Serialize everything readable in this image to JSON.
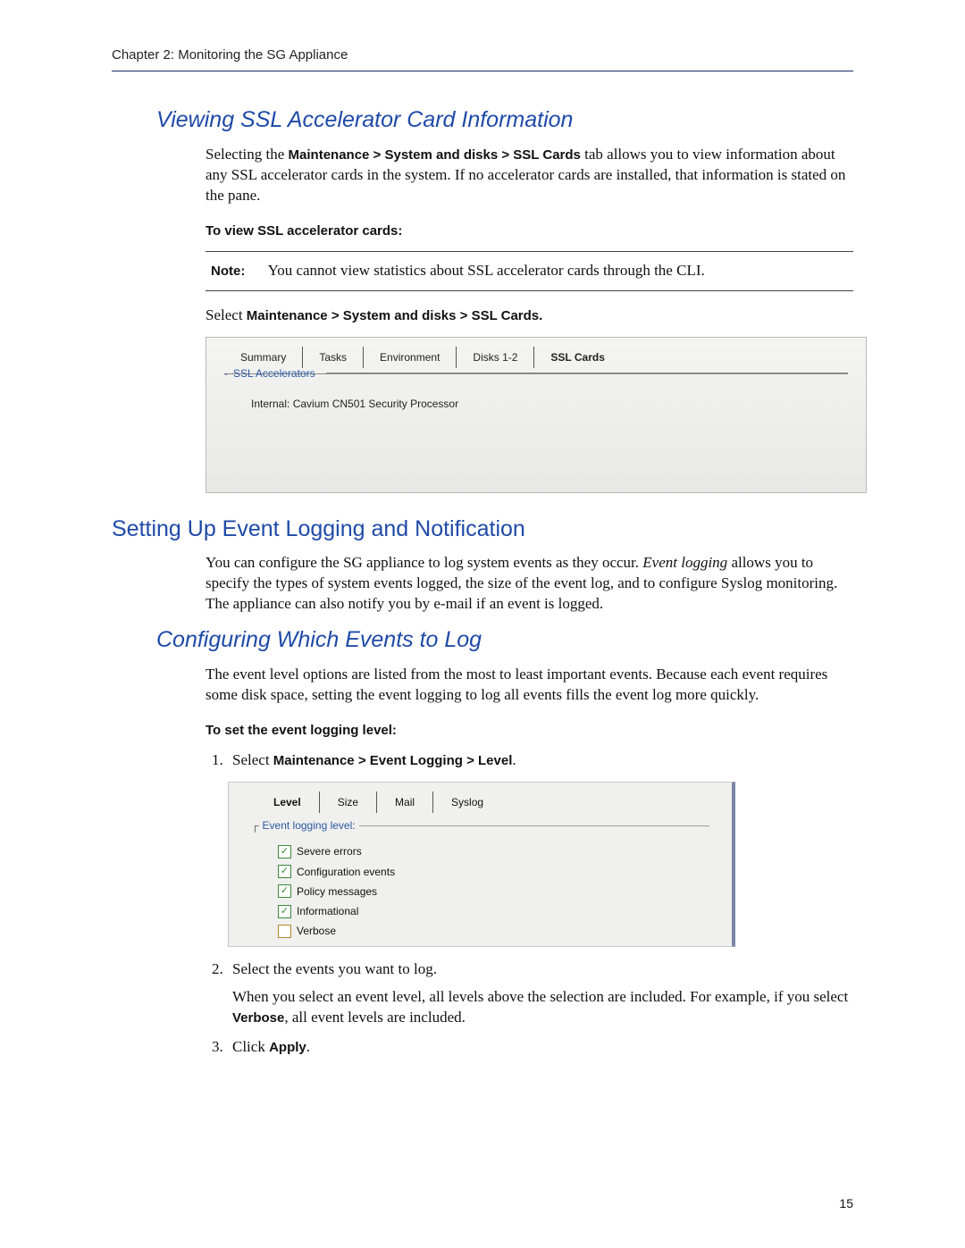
{
  "chapter": "Chapter 2:  Monitoring the SG Appliance",
  "section1": {
    "title": "Viewing SSL Accelerator Card Information",
    "para_pre": "Selecting the ",
    "nav_bold": "Maintenance > System and disks > SSL Cards",
    "para_post": " tab allows you to view information about any SSL accelerator cards in the system. If no accelerator cards are installed, that information is stated on the pane.",
    "sub": "To view SSL accelerator cards:",
    "note_label": "Note:",
    "note_text": "You cannot view statistics about SSL accelerator cards through the CLI.",
    "select_pre": "Select ",
    "select_bold": "Maintenance > System and disks > SSL Cards."
  },
  "ss1": {
    "tabs": [
      "Summary",
      "Tasks",
      "Environment",
      "Disks 1-2",
      "SSL Cards"
    ],
    "group": "SSL Accelerators",
    "content": "Internal: Cavium CN501 Security Processor"
  },
  "section2": {
    "title": "Setting Up Event Logging and Notification",
    "para": "You can configure the SG appliance to log system events as they occur. Event logging allows you to specify the types of system events logged, the size of the event log, and to configure Syslog monitoring. The appliance can also notify you by e-mail if an event is logged.",
    "para_italic": "Event logging"
  },
  "section3": {
    "title": "Configuring Which Events to Log",
    "para": "The event level options are listed from the most to least important events. Because each event requires some disk space, setting the event logging to log all events fills the event log more quickly.",
    "sub": "To set the event logging level:",
    "step1_pre": "Select ",
    "step1_bold": "Maintenance > Event Logging > Level",
    "step1_post": ".",
    "step2": "Select the events you want to log.",
    "step2_sub_pre": "When you select an event level, all levels above the selection are included. For example, if you select ",
    "step2_sub_bold": "Verbose",
    "step2_sub_post": ", all event levels are included.",
    "step3_pre": "Click ",
    "step3_bold": "Apply",
    "step3_post": "."
  },
  "ss2": {
    "tabs": [
      "Level",
      "Size",
      "Mail",
      "Syslog"
    ],
    "group": "Event logging level:",
    "items": [
      {
        "label": "Severe errors",
        "checked": true
      },
      {
        "label": "Configuration events",
        "checked": true
      },
      {
        "label": "Policy messages",
        "checked": true
      },
      {
        "label": "Informational",
        "checked": true
      },
      {
        "label": "Verbose",
        "checked": false
      }
    ]
  },
  "page_number": "15"
}
